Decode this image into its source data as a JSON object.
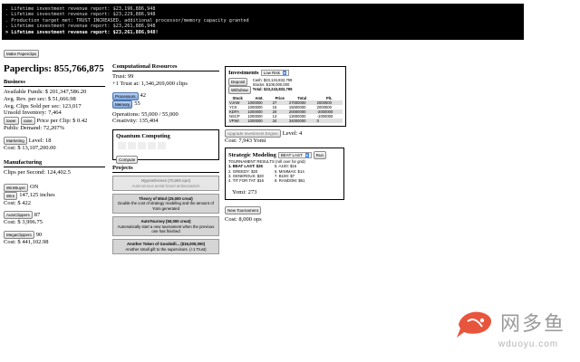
{
  "console": {
    "lines": [
      ". Lifetime investment revenue report: $23,196,886,948",
      ". Lifetime investment revenue report: $23,229,886,948",
      ". Production target met: TRUST INCREASED, additional processor/memory capacity granted",
      ". Lifetime investment revenue report: $23,261,886,948",
      "> Lifetime investment revenue report: $23,261,886,948!"
    ]
  },
  "left": {
    "make_button": "Make Paperclips",
    "paperclips": "Paperclips: 855,766,875",
    "business": {
      "title": "Business",
      "funds": "Available Funds: $ 201,347,586.20",
      "avg_rev": "Avg. Rev. per sec: $ 51,666.98",
      "avg_sold": "Avg. Clips Sold per sec: 123,017",
      "unsold": "Unsold Inventory: 7,464",
      "lower": "lower",
      "raise": "raise",
      "price": "Price per Clip: $ 0.42",
      "demand": "Public Demand: 72,207%",
      "marketing_btn": "Marketing",
      "marketing_level": "Level: 18",
      "marketing_cost": "Cost: $ 13,107,200.00"
    },
    "manufacturing": {
      "title": "Manufacturing",
      "cps": "Clips per Second: 124,402.5",
      "wirebuyer_btn": "WireBuyer",
      "wirebuyer_state": "ON",
      "wire_btn": "Wire",
      "wire_inches": "147,125 inches",
      "wire_cost": "Cost: $ 422",
      "autoclippers_btn": "AutoClippers",
      "autoclippers_count": "87",
      "autoclippers_cost": "Cost: $ 3,996.75",
      "megaclippers_btn": "MegaClippers",
      "megaclippers_count": "90",
      "megaclippers_cost": "Cost: $ 441,102.98"
    }
  },
  "middle": {
    "comp_title": "Computational Resources",
    "trust": "Trust: 99",
    "next_trust": "+1 Trust at: 1,346,269,000 clips",
    "processors_btn": "Processors",
    "processors_val": "42",
    "memory_btn": "Memory",
    "memory_val": "55",
    "operations": "Operations: 55,000 / 55,000",
    "creativity": "Creativity: 135,404",
    "quantum_title": "Quantum Computing",
    "compute_btn": "Compute",
    "projects_title": "Projects",
    "projects": [
      {
        "title": "HypnoDrones (70,000 ops)",
        "desc": "Autonomous aerial brand ambassadors"
      },
      {
        "title": "Theory of Mind (25,000 creat)",
        "desc": "Double the cost of strategy modeling and the amount of Yomi generated"
      },
      {
        "title": "AutoTourney (50,000 creat)",
        "desc": "Automatically start a new tournament when the previous one has finished"
      },
      {
        "title": "Another Token of Goodwill... ($16,000,000)",
        "desc": "Another small gift to the supervisors. (+1 Trust)"
      }
    ]
  },
  "right": {
    "inv_title": "Investments",
    "risk": "Low Risk",
    "deposit_btn": "Deposit",
    "withdraw_btn": "Withdraw",
    "cash": "Cash: $23,134,832,799",
    "stocks": "Stocks: $109,000,000",
    "total": "Total: $23,243,832,799",
    "table_headers": [
      "Stock",
      "Amt.",
      "Price",
      "Total",
      "P/L"
    ],
    "table_rows": [
      [
        "VJAW",
        "1000000",
        "27",
        "27000000",
        "2000000"
      ],
      [
        "YCK",
        "1000000",
        "15",
        "15000000",
        "2000000"
      ],
      [
        "KDFA",
        "1000000",
        "20",
        "20000000",
        "-2000000"
      ],
      [
        "NSCP",
        "1000000",
        "13",
        "13000000",
        "-1000000"
      ],
      [
        "VPWI",
        "1000000",
        "34",
        "34000000",
        "0"
      ]
    ],
    "upgrade_btn": "Upgrade Investment Engine",
    "upgrade_level": "Level: 4",
    "upgrade_cost": "Cost: 7,943 Yomi",
    "strat_title": "Strategic Modeling",
    "strat_select": "BEAT LAST",
    "run_btn": "Run",
    "tourn_header": "TOURNAMENT RESULTS (roll over for grid)",
    "results_left": [
      "1. BEAT LAST: $26",
      "2. GREEDY: $20",
      "3. GENEROUS: $20",
      "4. TIT FOR TAT: $16"
    ],
    "results_right": [
      "5. A100: $16",
      "6. MINIMAX: $14",
      "7. B100: $7",
      "8. RANDOM: $61"
    ],
    "yomi": "Yomi: 273",
    "new_tourn_btn": "New Tournament",
    "new_tourn_cost": "Cost: 8,000 ops"
  },
  "watermark": {
    "text": "网多鱼",
    "url": "wduoyu.com",
    "fish_color": "#e8553d"
  }
}
